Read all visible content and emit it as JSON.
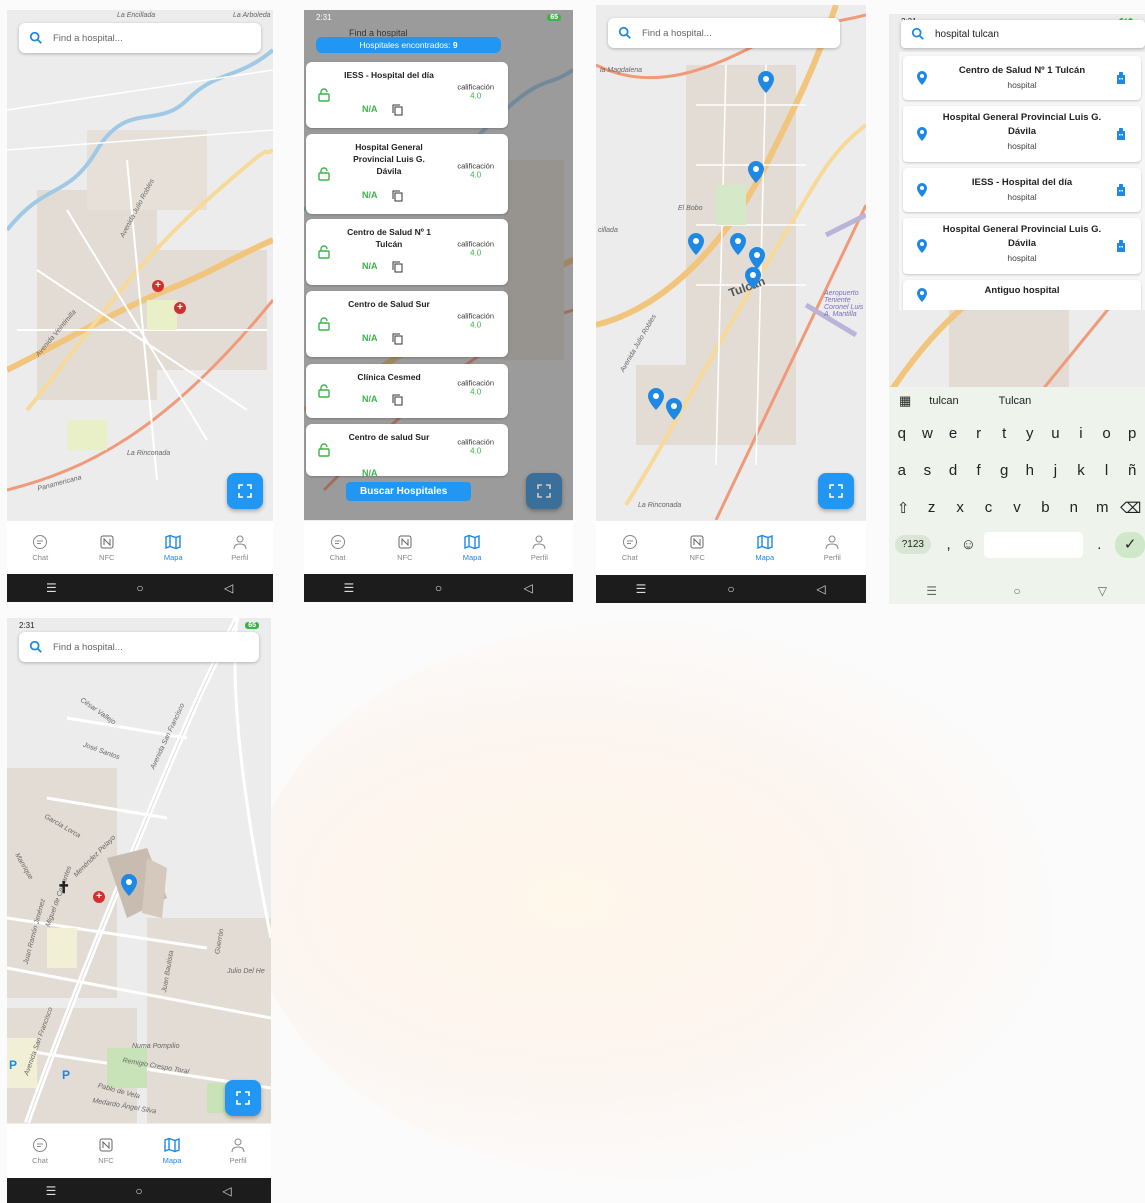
{
  "colors": {
    "accent": "#2196f3",
    "green": "#39b54a",
    "map_bg": "#ececec",
    "road_major": "#f2c57c",
    "river": "#a0c9e6",
    "hospital_red": "#d32f2f"
  },
  "search": {
    "placeholder": "Find a hospital...",
    "query": "hospital tulcan",
    "icon": "search-icon"
  },
  "status": {
    "time": "2:31",
    "battery": "65"
  },
  "bottom_nav": [
    {
      "label": "Chat",
      "icon": "chat-icon"
    },
    {
      "label": "NFC",
      "icon": "nfc-icon"
    },
    {
      "label": "Mapa",
      "icon": "map-icon",
      "active": true
    },
    {
      "label": "Perfil",
      "icon": "user-icon"
    }
  ],
  "system_nav": [
    "☰",
    "○",
    "◁"
  ],
  "panel2": {
    "banner_label": "Hospitales encontrados:",
    "banner_count": "9",
    "search_text": "Find a hospital",
    "rating_label": "calificación",
    "availability": "N/A",
    "hospitals": [
      {
        "name": "IESS - Hospital del día",
        "rating": "4.0"
      },
      {
        "name": "Hospital General Provincial Luis G. Dávila",
        "rating": "4.0"
      },
      {
        "name": "Centro de Salud Nº 1 Tulcán",
        "rating": "4.0"
      },
      {
        "name": "Centro de Salud Sur",
        "rating": "4.0"
      },
      {
        "name": "Clínica Cesmed",
        "rating": "4.0"
      },
      {
        "name": "Centro de salud Sur",
        "rating": "4.0"
      }
    ],
    "search_button": "Buscar Hospitales"
  },
  "panel4": {
    "results": [
      {
        "name": "Centro de Salud Nº 1 Tulcán",
        "type": "hospital"
      },
      {
        "name": "Hospital General Provincial Luis G. Dávila",
        "type": "hospital"
      },
      {
        "name": "IESS - Hospital del día",
        "type": "hospital"
      },
      {
        "name": "Hospital General Provincial Luis G. Dávila",
        "type": "hospital"
      },
      {
        "name": "Antiguo hospital",
        "type": ""
      }
    ],
    "suggestions": [
      "tulcan",
      "Tulcan"
    ],
    "keyboard_rows": [
      [
        "q",
        "w",
        "e",
        "r",
        "t",
        "y",
        "u",
        "i",
        "o",
        "p"
      ],
      [
        "a",
        "s",
        "d",
        "f",
        "g",
        "h",
        "j",
        "k",
        "l",
        "ñ"
      ],
      [
        "⇧",
        "z",
        "x",
        "c",
        "v",
        "b",
        "n",
        "m",
        "⌫"
      ]
    ],
    "key_numbers": "?123",
    "key_comma": ",",
    "key_period": ".",
    "key_emoji": "☺",
    "key_enter": "✓"
  },
  "map_labels": {
    "p1": [
      "La Encillada",
      "La Arboleda",
      "Avenida Julio Robles",
      "Avenida Veintimilla",
      "Panamericana",
      "La Rinconada"
    ],
    "p3": [
      "la Magdalena",
      "El Bobo",
      "Tulcán",
      "Aeropuerto Teniente Coronel Luis A. Mantilla",
      "Avenida Julio Robles",
      "La Rinconada",
      "cillada"
    ],
    "p5": [
      "César Vallejo",
      "José Santos",
      "Avenida San Francisco",
      "García Lorca",
      "Manrique",
      "Juan Ramón Jiménez",
      "Miguel de Cervantes",
      "Menéndez Pelayo",
      "Julio Del He",
      "Numa Pompilio",
      "Remigio Crespo Toral",
      "Pablo de Vela",
      "Medardo Ángel Silva",
      "Avenida San Francisco",
      "Guerrón",
      "Juan Bautista"
    ]
  }
}
